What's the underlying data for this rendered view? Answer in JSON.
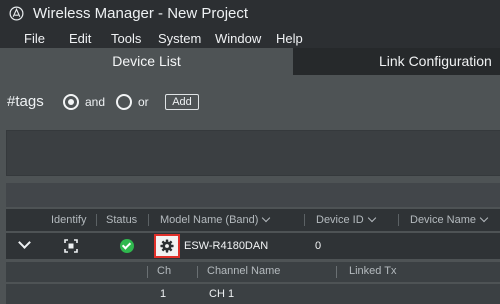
{
  "window": {
    "title": "Wireless Manager - New Project"
  },
  "menu": [
    "File",
    "Edit",
    "Tools",
    "System",
    "Window",
    "Help"
  ],
  "tabs": {
    "active": "Device List",
    "inactive": "Link Configuration"
  },
  "tags": {
    "label": "#tags",
    "and_label": "and",
    "or_label": "or",
    "add_label": "Add",
    "selected": "and"
  },
  "table": {
    "headers": {
      "identify": "Identify",
      "status": "Status",
      "model": "Model Name (Band)",
      "device_id": "Device ID",
      "device_name": "Device Name"
    },
    "device": {
      "model": "ESW-R4180DAN",
      "device_id": "0",
      "status_color": "#2fb84e"
    },
    "channels": {
      "headers": {
        "ch": "Ch",
        "channel_name": "Channel Name",
        "linked_tx": "Linked Tx"
      },
      "rows": [
        {
          "ch": "1",
          "channel_name": "CH 1"
        }
      ]
    }
  },
  "colors": {
    "highlight": "#e0302a",
    "status_ok": "#2fb84e"
  },
  "icons": [
    "app-logo-icon",
    "expand-chevron-icon",
    "identify-icon",
    "status-ok-icon",
    "gear-icon",
    "sort-chevron-icon"
  ]
}
